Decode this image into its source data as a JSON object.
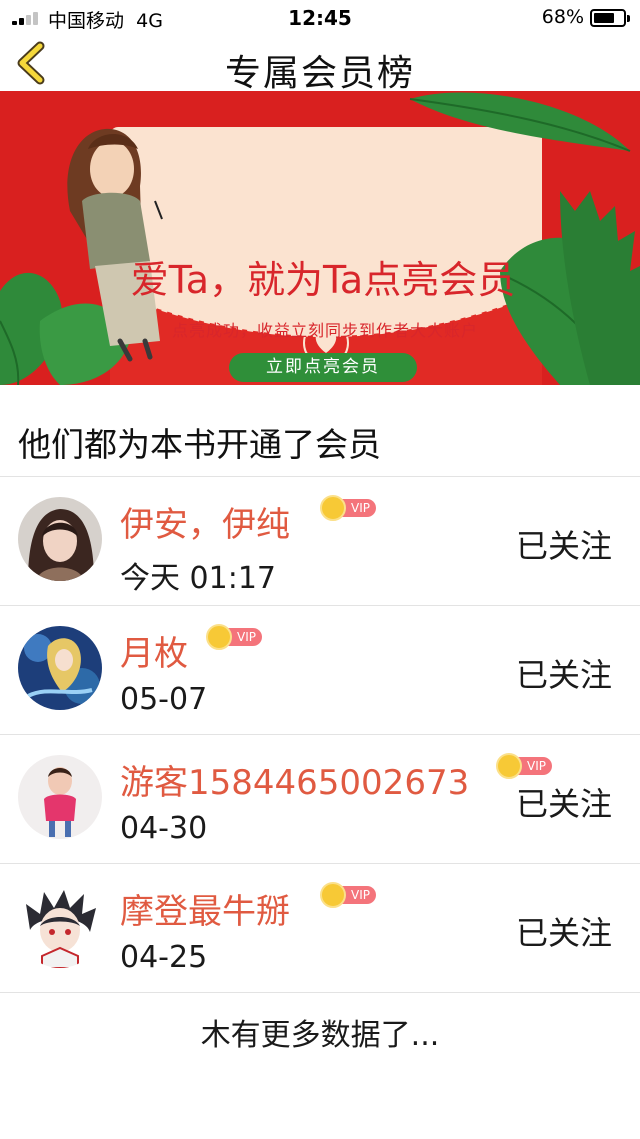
{
  "status_bar": {
    "carrier": "中国移动",
    "network": "4G",
    "time": "12:45",
    "battery_percent": "68%",
    "battery_level": 0.68,
    "signal_bars": 2
  },
  "nav": {
    "back_icon": "chevron-left-icon",
    "title": "专属会员榜"
  },
  "banner": {
    "headline": "爱Ta，就为Ta点亮会员",
    "subtitle": "点亮成功，收益立刻同步到作者大大账户",
    "button_label": "立即点亮会员",
    "colors": {
      "background": "#d9201f",
      "card": "#fbe3d0",
      "accent_text": "#d8262b",
      "button": "#2f8f39",
      "leaf": "#2f8a3a"
    }
  },
  "section": {
    "title": "他们都为本书开通了会员"
  },
  "members": [
    {
      "name": "伊安，伊纯",
      "vip_label": "VIP",
      "date": "今天 01:17",
      "follow_label": "已关注",
      "avatar": "avatar-photo-girl"
    },
    {
      "name": "月枚",
      "vip_label": "VIP",
      "date": "05-07",
      "follow_label": "已关注",
      "avatar": "avatar-anime-art"
    },
    {
      "name": "游客1584465002673",
      "vip_label": "VIP",
      "date": "04-30",
      "follow_label": "已关注",
      "avatar": "avatar-photo-child"
    },
    {
      "name": "摩登最牛掰",
      "vip_label": "VIP",
      "date": "04-25",
      "follow_label": "已关注",
      "avatar": "avatar-anime-boy"
    }
  ],
  "footer": {
    "note": "木有更多数据了..."
  },
  "colors": {
    "name_text": "#e05a41",
    "vip_pill": "#f4747b",
    "crown": "#f7c936",
    "divider": "#e3e3e3"
  }
}
